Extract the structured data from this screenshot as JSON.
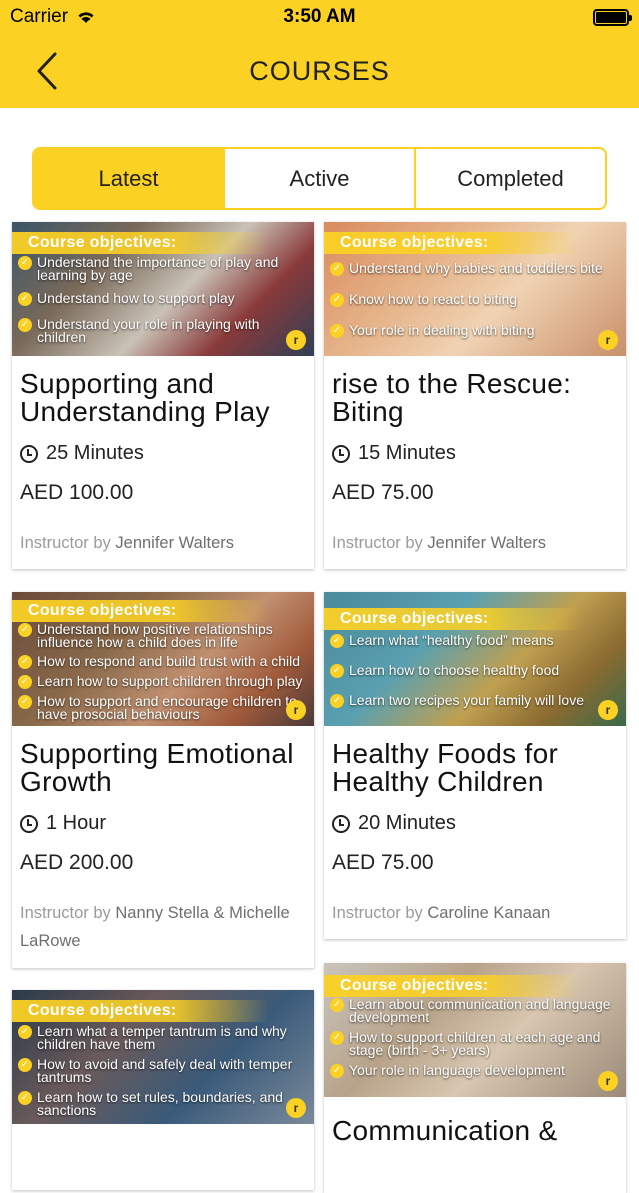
{
  "status": {
    "carrier": "Carrier",
    "time": "3:50 AM"
  },
  "nav": {
    "title": "COURSES"
  },
  "tabs": [
    "Latest",
    "Active",
    "Completed"
  ],
  "objectives_heading": "Course objectives:",
  "logo_mark": "r",
  "instructor_prefix": "Instructor by",
  "courses": [
    {
      "title": "Supporting and Understanding Play",
      "duration": "25 Minutes",
      "price": "AED 100.00",
      "instructor": "Jennifer Walters",
      "objectives": [
        "Understand the importance of play and learning by age",
        "Understand how to support play",
        "Understand your role in playing with children"
      ]
    },
    {
      "title": "rise to the Rescue: Biting",
      "duration": "15 Minutes",
      "price": "AED 75.00",
      "instructor": "Jennifer Walters",
      "objectives": [
        "Understand why babies and toddlers bite",
        "Know how to react to biting",
        "Your role in dealing with biting"
      ]
    },
    {
      "title": "Supporting Emotional Growth",
      "duration": "1 Hour",
      "price": "AED 200.00",
      "instructor": "Nanny Stella & Michelle LaRowe",
      "objectives": [
        "Understand how positive relationships influence how a child does in life",
        "How to respond and build trust with a child",
        "Learn how to support children through play",
        "How to support and encourage children to have prosocial behaviours"
      ]
    },
    {
      "title": "Healthy Foods for Healthy Children",
      "duration": "20 Minutes",
      "price": "AED 75.00",
      "instructor": "Caroline Kanaan",
      "objectives": [
        "Learn what “healthy food” means",
        "Learn how to choose healthy food",
        "Learn two recipes your family will love"
      ]
    },
    {
      "title": "",
      "duration": "",
      "price": "",
      "instructor": "",
      "objectives": [
        "Learn what a temper tantrum is and why children have them",
        "How to avoid and safely deal with temper tantrums",
        "Learn how to set rules, boundaries, and sanctions"
      ]
    },
    {
      "title": "Communication &",
      "duration": "",
      "price": "",
      "instructor": "",
      "objectives": [
        "Learn about communication and language development",
        "How to support children at each age and stage (birth - 3+ years)",
        "Your role in language development"
      ]
    }
  ]
}
